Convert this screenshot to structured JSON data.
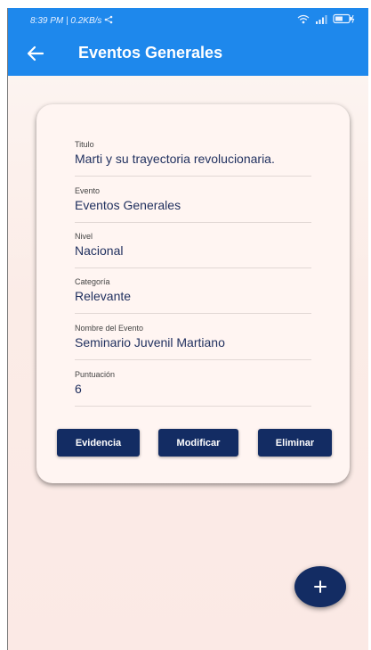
{
  "status_bar": {
    "time_speed": "8:39 PM | 0.2KB/s"
  },
  "app_bar": {
    "title": "Eventos Generales"
  },
  "fields": [
    {
      "label": "Titulo",
      "value": "Marti y su trayectoria revolucionaria."
    },
    {
      "label": "Evento",
      "value": "Eventos Generales"
    },
    {
      "label": "Nivel",
      "value": "Nacional"
    },
    {
      "label": "Categoría",
      "value": "Relevante"
    },
    {
      "label": "Nombre del Evento",
      "value": "Seminario Juvenil Martiano"
    },
    {
      "label": "Puntuación",
      "value": "6"
    }
  ],
  "buttons": {
    "evidence": "Evidencia",
    "modify": "Modificar",
    "delete": "Eliminar"
  },
  "fab": {
    "symbol": "+"
  },
  "colors": {
    "app_bar": "#1e88ec",
    "button": "#132c63",
    "card": "#fff5f2",
    "value_text": "#1f2f5e"
  },
  "icons": [
    "share-icon",
    "wifi-icon",
    "signal-icon",
    "battery-icon",
    "back-arrow-icon",
    "plus-icon"
  ]
}
